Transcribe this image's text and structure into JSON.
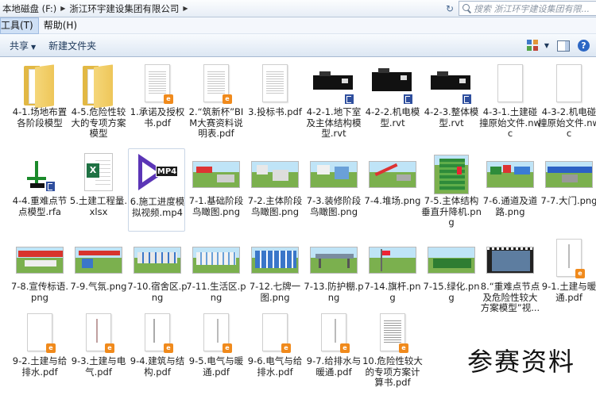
{
  "address_bar": {
    "crumbs": [
      "本地磁盘 (F:)",
      "浙江环宇建设集团有限公司"
    ],
    "search_placeholder": "搜索 浙江环宇建设集团有限..."
  },
  "menubar": {
    "items": [
      "工具(T)",
      "帮助(H)"
    ]
  },
  "toolbar": {
    "share_label": "共享",
    "new_folder_label": "新建文件夹"
  },
  "icons": {
    "refresh": "refresh-icon",
    "search": "search-icon",
    "view": "view-options-icon",
    "pane": "preview-pane-icon",
    "help": "help-icon"
  },
  "help_glyph": "?",
  "colors": {
    "accent": "#2d67c4",
    "folder": "#eec659",
    "pdf_badge": "#f08a1c",
    "excel": "#1f7244",
    "video": "#5b35b6"
  },
  "files": [
    {
      "name": "4-1.场地布置各阶段模型",
      "type": "folder"
    },
    {
      "name": "4-5.危险性较大的专项方案模型",
      "type": "folder"
    },
    {
      "name": "1.承诺及授权书.pdf",
      "type": "pdf"
    },
    {
      "name": "2.“筑新杯”BIM大赛资料说明表.pdf",
      "type": "pdf"
    },
    {
      "name": "3.投标书.pdf",
      "type": "pdf"
    },
    {
      "name": "4-2-1.地下室及主体结构模型.rvt",
      "type": "rvt"
    },
    {
      "name": "4-2-2.机电模型.rvt",
      "type": "rvt"
    },
    {
      "name": "4-2-3.整体模型.rvt",
      "type": "rvt"
    },
    {
      "name": "4-3-1.土建碰撞原始文件.nwc",
      "type": "nwc"
    },
    {
      "name": "4-3-2.机电碰撞原始文件.nwc",
      "type": "nwc"
    },
    {
      "name": "4-4.重难点节点模型.rfa",
      "type": "rfa"
    },
    {
      "name": "5.土建工程量.xlsx",
      "type": "xlsx"
    },
    {
      "name": "6.施工进度模拟视频.mp4",
      "type": "mp4"
    },
    {
      "name": "7-1.基础阶段鸟瞰图.png",
      "type": "png"
    },
    {
      "name": "7-2.主体阶段鸟瞰图.png",
      "type": "png"
    },
    {
      "name": "7-3.装修阶段鸟瞰图.png",
      "type": "png"
    },
    {
      "name": "7-4.堆场.png",
      "type": "png"
    },
    {
      "name": "7-5.主体结构垂直升降机.png",
      "type": "png"
    },
    {
      "name": "7-6.通道及道路.png",
      "type": "png"
    },
    {
      "name": "7-7.大门.png",
      "type": "png"
    },
    {
      "name": "7-8.宣传标语.png",
      "type": "png"
    },
    {
      "name": "7-9.气氛.png",
      "type": "png"
    },
    {
      "name": "7-10.宿舍区.png",
      "type": "png"
    },
    {
      "name": "7-11.生活区.png",
      "type": "png"
    },
    {
      "name": "7-12.七牌一图.png",
      "type": "png"
    },
    {
      "name": "7-13.防护棚.png",
      "type": "png"
    },
    {
      "name": "7-14.旗杆.png",
      "type": "png"
    },
    {
      "name": "7-15.绿化.png",
      "type": "png"
    },
    {
      "name": "8.“重难点节点及危险性较大方案模型”视...",
      "type": "video"
    },
    {
      "name": "9-1.土建与暖通.pdf",
      "type": "pdf"
    },
    {
      "name": "9-2.土建与给排水.pdf",
      "type": "pdf"
    },
    {
      "name": "9-3.土建与电气.pdf",
      "type": "pdf"
    },
    {
      "name": "9-4.建筑与结构.pdf",
      "type": "pdf"
    },
    {
      "name": "9-5.电气与暖通.pdf",
      "type": "pdf"
    },
    {
      "name": "9-6.电气与给排水.pdf",
      "type": "pdf"
    },
    {
      "name": "9-7.给排水与暖通.pdf",
      "type": "pdf"
    },
    {
      "name": "10.危险性较大的专项方案计算书.pdf",
      "type": "pdf"
    }
  ],
  "watermark": "参赛资料"
}
